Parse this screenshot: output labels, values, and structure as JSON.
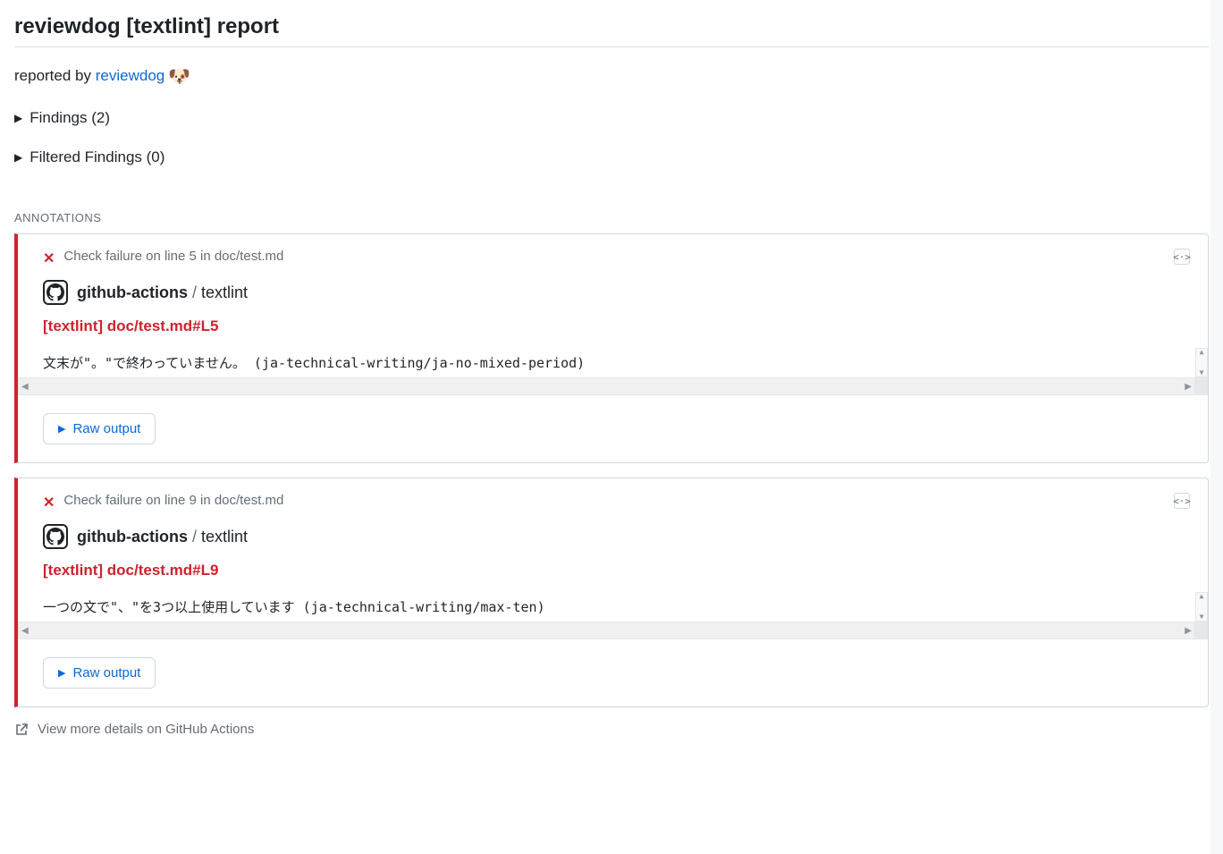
{
  "title": "reviewdog [textlint] report",
  "reportedBy": {
    "prefix": "reported by ",
    "linkText": "reviewdog",
    "emoji": "🐶"
  },
  "findings": {
    "label": "Findings (2)"
  },
  "filteredFindings": {
    "label": "Filtered Findings (0)"
  },
  "sectionHeading": "ANNOTATIONS",
  "annotations": [
    {
      "failureText": "Check failure on line 5 in doc/test.md",
      "workflowBold": "github-actions",
      "workflowSep": " / ",
      "workflowCheck": "textlint",
      "annotationTitle": "[textlint] doc/test.md#L5",
      "message": "文末が\"。\"で終わっていません。 (ja-technical-writing/ja-no-mixed-period)",
      "rawOutputLabel": "Raw output"
    },
    {
      "failureText": "Check failure on line 9 in doc/test.md",
      "workflowBold": "github-actions",
      "workflowSep": " / ",
      "workflowCheck": "textlint",
      "annotationTitle": "[textlint] doc/test.md#L9",
      "message": "一つの文で\"、\"を3つ以上使用しています (ja-technical-writing/max-ten)",
      "rawOutputLabel": "Raw output"
    }
  ],
  "viewMoreLabel": "View more details on GitHub Actions"
}
